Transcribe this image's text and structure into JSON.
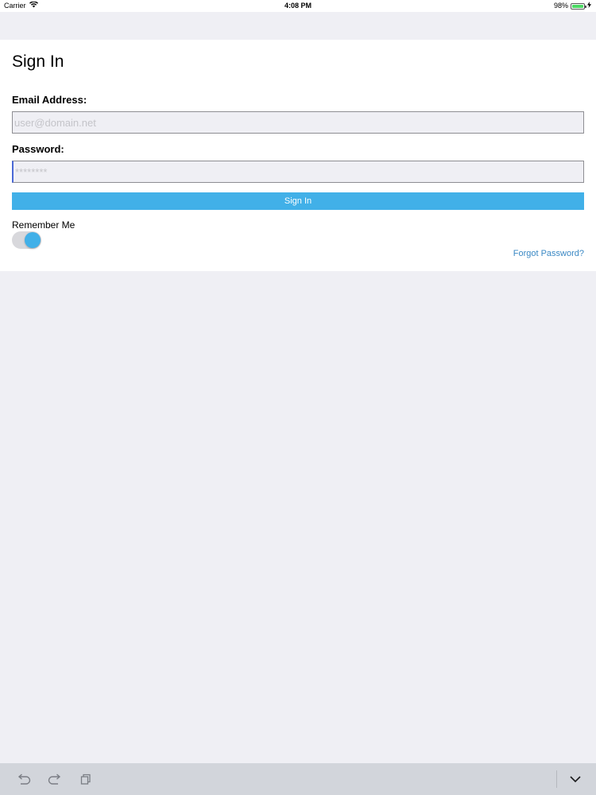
{
  "status_bar": {
    "carrier": "Carrier",
    "time": "4:08 PM",
    "battery_percent": "98%",
    "battery_level": 0.98,
    "icons": [
      "wifi-icon",
      "battery-icon",
      "charging-icon"
    ]
  },
  "signin_form": {
    "title": "Sign In",
    "email_label": "Email Address:",
    "email_value": "",
    "email_placeholder": "user@domain.net",
    "password_label": "Password:",
    "password_value": "",
    "password_placeholder": "********",
    "signin_button_label": "Sign In",
    "remember_label": "Remember Me",
    "remember_enabled": true,
    "forgot_link": "Forgot Password?"
  },
  "keyboard_toolbar": {
    "icons": [
      "undo-icon",
      "redo-icon",
      "paste-icon",
      "keyboard-dismiss-icon"
    ]
  },
  "colors": {
    "accent": "#41b0e8",
    "link": "#3a88c4",
    "background": "#efeff4",
    "card": "#ffffff",
    "toolbar": "#d2d5db"
  }
}
